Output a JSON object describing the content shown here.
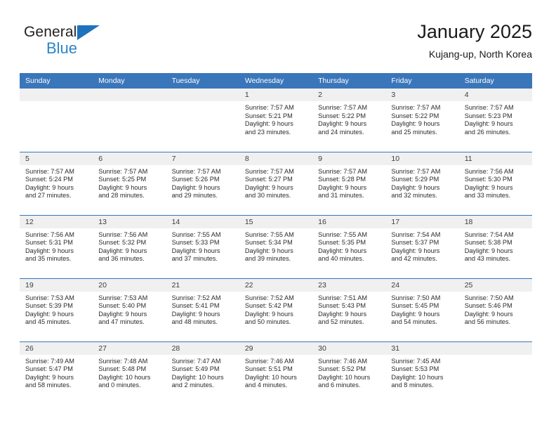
{
  "brand": {
    "line1": "General",
    "line2": "Blue",
    "triangle_color": "#1f72bd",
    "line2_color": "#2a86c8"
  },
  "header": {
    "title": "January 2025",
    "subtitle": "Kujang-up, North Korea"
  },
  "colors": {
    "header_blue": "#3a76ba",
    "daynum_band": "#f0f0f0",
    "cell_bg": "#ffffff",
    "text": "#2b2b2b"
  },
  "weekday_headers": [
    "Sunday",
    "Monday",
    "Tuesday",
    "Wednesday",
    "Thursday",
    "Friday",
    "Saturday"
  ],
  "weeks": [
    [
      {
        "day": "",
        "sunrise": "",
        "sunset": "",
        "daylight1": "",
        "daylight2": ""
      },
      {
        "day": "",
        "sunrise": "",
        "sunset": "",
        "daylight1": "",
        "daylight2": ""
      },
      {
        "day": "",
        "sunrise": "",
        "sunset": "",
        "daylight1": "",
        "daylight2": ""
      },
      {
        "day": "1",
        "sunrise": "Sunrise: 7:57 AM",
        "sunset": "Sunset: 5:21 PM",
        "daylight1": "Daylight: 9 hours",
        "daylight2": "and 23 minutes."
      },
      {
        "day": "2",
        "sunrise": "Sunrise: 7:57 AM",
        "sunset": "Sunset: 5:22 PM",
        "daylight1": "Daylight: 9 hours",
        "daylight2": "and 24 minutes."
      },
      {
        "day": "3",
        "sunrise": "Sunrise: 7:57 AM",
        "sunset": "Sunset: 5:22 PM",
        "daylight1": "Daylight: 9 hours",
        "daylight2": "and 25 minutes."
      },
      {
        "day": "4",
        "sunrise": "Sunrise: 7:57 AM",
        "sunset": "Sunset: 5:23 PM",
        "daylight1": "Daylight: 9 hours",
        "daylight2": "and 26 minutes."
      }
    ],
    [
      {
        "day": "5",
        "sunrise": "Sunrise: 7:57 AM",
        "sunset": "Sunset: 5:24 PM",
        "daylight1": "Daylight: 9 hours",
        "daylight2": "and 27 minutes."
      },
      {
        "day": "6",
        "sunrise": "Sunrise: 7:57 AM",
        "sunset": "Sunset: 5:25 PM",
        "daylight1": "Daylight: 9 hours",
        "daylight2": "and 28 minutes."
      },
      {
        "day": "7",
        "sunrise": "Sunrise: 7:57 AM",
        "sunset": "Sunset: 5:26 PM",
        "daylight1": "Daylight: 9 hours",
        "daylight2": "and 29 minutes."
      },
      {
        "day": "8",
        "sunrise": "Sunrise: 7:57 AM",
        "sunset": "Sunset: 5:27 PM",
        "daylight1": "Daylight: 9 hours",
        "daylight2": "and 30 minutes."
      },
      {
        "day": "9",
        "sunrise": "Sunrise: 7:57 AM",
        "sunset": "Sunset: 5:28 PM",
        "daylight1": "Daylight: 9 hours",
        "daylight2": "and 31 minutes."
      },
      {
        "day": "10",
        "sunrise": "Sunrise: 7:57 AM",
        "sunset": "Sunset: 5:29 PM",
        "daylight1": "Daylight: 9 hours",
        "daylight2": "and 32 minutes."
      },
      {
        "day": "11",
        "sunrise": "Sunrise: 7:56 AM",
        "sunset": "Sunset: 5:30 PM",
        "daylight1": "Daylight: 9 hours",
        "daylight2": "and 33 minutes."
      }
    ],
    [
      {
        "day": "12",
        "sunrise": "Sunrise: 7:56 AM",
        "sunset": "Sunset: 5:31 PM",
        "daylight1": "Daylight: 9 hours",
        "daylight2": "and 35 minutes."
      },
      {
        "day": "13",
        "sunrise": "Sunrise: 7:56 AM",
        "sunset": "Sunset: 5:32 PM",
        "daylight1": "Daylight: 9 hours",
        "daylight2": "and 36 minutes."
      },
      {
        "day": "14",
        "sunrise": "Sunrise: 7:55 AM",
        "sunset": "Sunset: 5:33 PM",
        "daylight1": "Daylight: 9 hours",
        "daylight2": "and 37 minutes."
      },
      {
        "day": "15",
        "sunrise": "Sunrise: 7:55 AM",
        "sunset": "Sunset: 5:34 PM",
        "daylight1": "Daylight: 9 hours",
        "daylight2": "and 39 minutes."
      },
      {
        "day": "16",
        "sunrise": "Sunrise: 7:55 AM",
        "sunset": "Sunset: 5:35 PM",
        "daylight1": "Daylight: 9 hours",
        "daylight2": "and 40 minutes."
      },
      {
        "day": "17",
        "sunrise": "Sunrise: 7:54 AM",
        "sunset": "Sunset: 5:37 PM",
        "daylight1": "Daylight: 9 hours",
        "daylight2": "and 42 minutes."
      },
      {
        "day": "18",
        "sunrise": "Sunrise: 7:54 AM",
        "sunset": "Sunset: 5:38 PM",
        "daylight1": "Daylight: 9 hours",
        "daylight2": "and 43 minutes."
      }
    ],
    [
      {
        "day": "19",
        "sunrise": "Sunrise: 7:53 AM",
        "sunset": "Sunset: 5:39 PM",
        "daylight1": "Daylight: 9 hours",
        "daylight2": "and 45 minutes."
      },
      {
        "day": "20",
        "sunrise": "Sunrise: 7:53 AM",
        "sunset": "Sunset: 5:40 PM",
        "daylight1": "Daylight: 9 hours",
        "daylight2": "and 47 minutes."
      },
      {
        "day": "21",
        "sunrise": "Sunrise: 7:52 AM",
        "sunset": "Sunset: 5:41 PM",
        "daylight1": "Daylight: 9 hours",
        "daylight2": "and 48 minutes."
      },
      {
        "day": "22",
        "sunrise": "Sunrise: 7:52 AM",
        "sunset": "Sunset: 5:42 PM",
        "daylight1": "Daylight: 9 hours",
        "daylight2": "and 50 minutes."
      },
      {
        "day": "23",
        "sunrise": "Sunrise: 7:51 AM",
        "sunset": "Sunset: 5:43 PM",
        "daylight1": "Daylight: 9 hours",
        "daylight2": "and 52 minutes."
      },
      {
        "day": "24",
        "sunrise": "Sunrise: 7:50 AM",
        "sunset": "Sunset: 5:45 PM",
        "daylight1": "Daylight: 9 hours",
        "daylight2": "and 54 minutes."
      },
      {
        "day": "25",
        "sunrise": "Sunrise: 7:50 AM",
        "sunset": "Sunset: 5:46 PM",
        "daylight1": "Daylight: 9 hours",
        "daylight2": "and 56 minutes."
      }
    ],
    [
      {
        "day": "26",
        "sunrise": "Sunrise: 7:49 AM",
        "sunset": "Sunset: 5:47 PM",
        "daylight1": "Daylight: 9 hours",
        "daylight2": "and 58 minutes."
      },
      {
        "day": "27",
        "sunrise": "Sunrise: 7:48 AM",
        "sunset": "Sunset: 5:48 PM",
        "daylight1": "Daylight: 10 hours",
        "daylight2": "and 0 minutes."
      },
      {
        "day": "28",
        "sunrise": "Sunrise: 7:47 AM",
        "sunset": "Sunset: 5:49 PM",
        "daylight1": "Daylight: 10 hours",
        "daylight2": "and 2 minutes."
      },
      {
        "day": "29",
        "sunrise": "Sunrise: 7:46 AM",
        "sunset": "Sunset: 5:51 PM",
        "daylight1": "Daylight: 10 hours",
        "daylight2": "and 4 minutes."
      },
      {
        "day": "30",
        "sunrise": "Sunrise: 7:46 AM",
        "sunset": "Sunset: 5:52 PM",
        "daylight1": "Daylight: 10 hours",
        "daylight2": "and 6 minutes."
      },
      {
        "day": "31",
        "sunrise": "Sunrise: 7:45 AM",
        "sunset": "Sunset: 5:53 PM",
        "daylight1": "Daylight: 10 hours",
        "daylight2": "and 8 minutes."
      },
      {
        "day": "",
        "sunrise": "",
        "sunset": "",
        "daylight1": "",
        "daylight2": ""
      }
    ]
  ]
}
